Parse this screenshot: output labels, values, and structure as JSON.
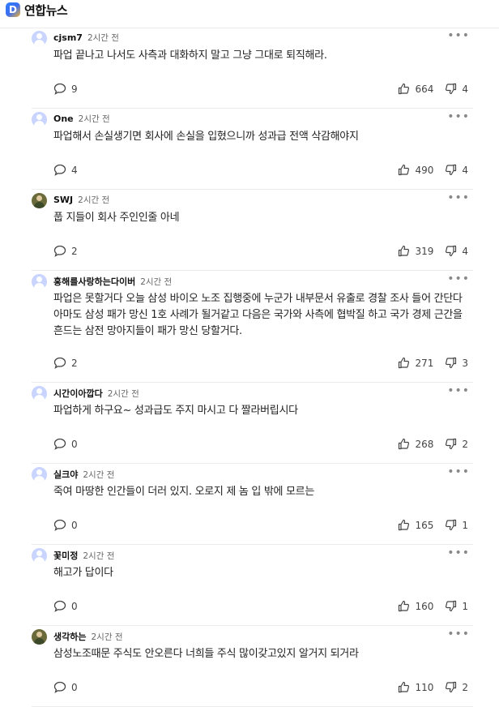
{
  "header": {
    "logo_letter": "D",
    "brand": "연합뉴스"
  },
  "comments": [
    {
      "nick": "cjsm7",
      "time": "2시간 전",
      "text": "파업 끝나고 나서도 사측과 대화하지 말고 그냥 그대로 퇴직해라.",
      "replies": "9",
      "likes": "664",
      "dislikes": "4",
      "more": "•••"
    },
    {
      "nick": "One",
      "time": "2시간 전",
      "text": "파업해서 손실생기면 회사에 손실을 입혔으니까 성과급 전액 삭감해야지",
      "replies": "4",
      "likes": "490",
      "dislikes": "4",
      "more": "•••"
    },
    {
      "nick": "SWJ",
      "time": "2시간 전",
      "text": "풉 지들이 회사 주인인줄 아네",
      "replies": "2",
      "likes": "319",
      "dislikes": "4",
      "more": "•••"
    },
    {
      "nick": "홍해를사랑하는다이버",
      "time": "2시간 전",
      "text": "파업은 못할거다 오늘 삼성 바이오 노조 집행중에 누군가 내부문서 유출로 경찰 조사 들어 간단다 아마도 삼성 패가 망신 1호 사례가 될거같고 다음은 국가와 사측에 협박질 하고 국가 경제 근간을 흔드는 삼전 망아지들이 패가 망신 당할거다.",
      "replies": "2",
      "likes": "271",
      "dislikes": "3",
      "more": "•••"
    },
    {
      "nick": "시간이아깝다",
      "time": "2시간 전",
      "text": "파업하게 하구요~ 성과급도 주지 마시고 다 짤라버립시다",
      "replies": "0",
      "likes": "268",
      "dislikes": "2",
      "more": "•••"
    },
    {
      "nick": "실크야",
      "time": "2시간 전",
      "text": "죽여 마땅한 인간들이 더러 있지. 오로지 제 놈 입 밖에 모르는",
      "replies": "0",
      "likes": "165",
      "dislikes": "1",
      "more": "•••"
    },
    {
      "nick": "꽃미정",
      "time": "2시간 전",
      "text": "해고가 답이다",
      "replies": "0",
      "likes": "160",
      "dislikes": "1",
      "more": "•••"
    },
    {
      "nick": "생각하는",
      "time": "2시간 전",
      "text": "삼성노조때문 주식도 안오른다 너희들 주식 많이갖고있지 알거지 되거라",
      "replies": "0",
      "likes": "110",
      "dislikes": "2",
      "more": "•••"
    }
  ]
}
